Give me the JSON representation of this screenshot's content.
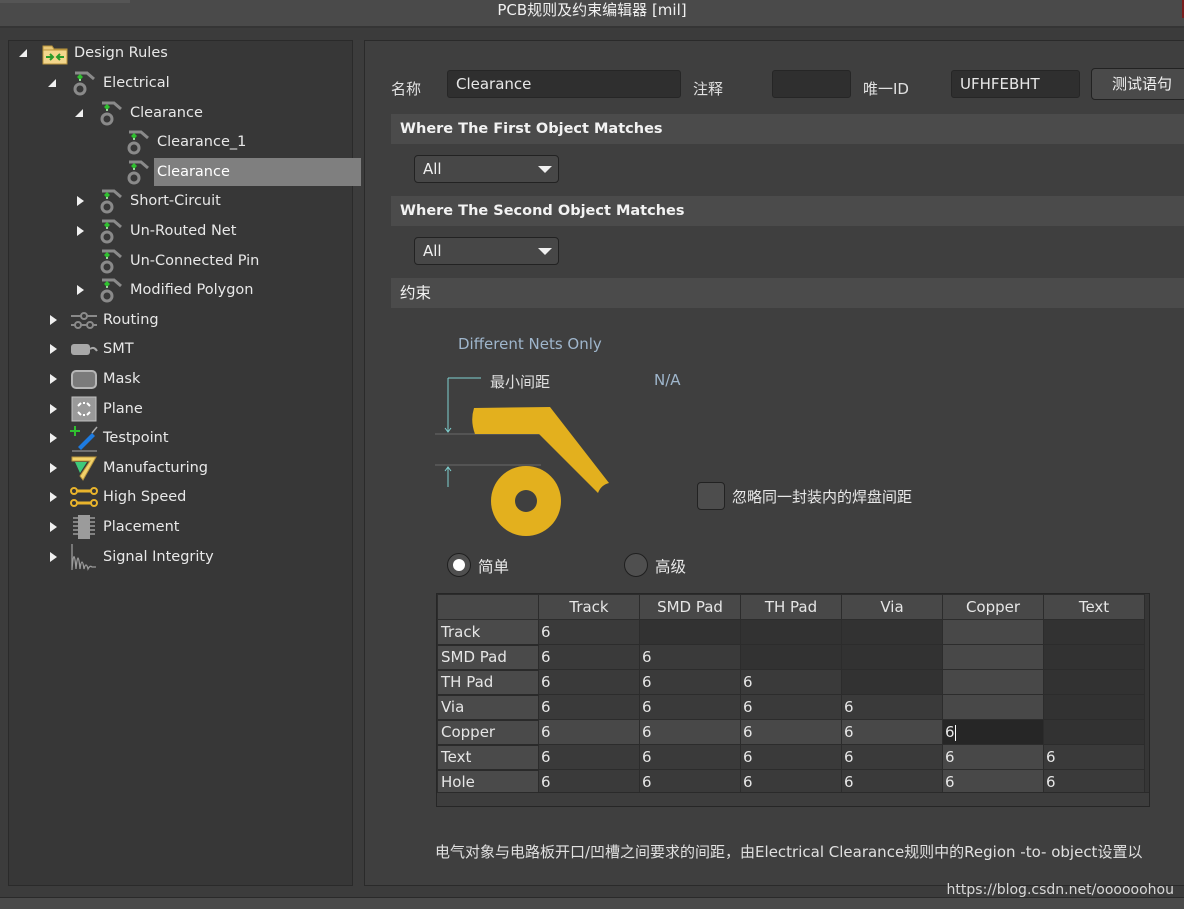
{
  "window": {
    "title": "PCB规则及约束编辑器 [mil]"
  },
  "tree": {
    "root": {
      "label": "Design Rules",
      "icon": "design-rules-folder-icon",
      "expanded": true
    },
    "items": [
      {
        "label": "Electrical",
        "level": 1,
        "expander": "down",
        "icon": "electrical-rule-icon"
      },
      {
        "label": "Clearance",
        "level": 2,
        "expander": "down",
        "icon": "electrical-rule-icon"
      },
      {
        "label": "Clearance_1",
        "level": 3,
        "expander": "none",
        "icon": "electrical-rule-icon"
      },
      {
        "label": "Clearance",
        "level": 3,
        "expander": "none",
        "icon": "electrical-rule-icon",
        "selected": true
      },
      {
        "label": "Short-Circuit",
        "level": 2,
        "expander": "right",
        "icon": "electrical-rule-icon"
      },
      {
        "label": "Un-Routed Net",
        "level": 2,
        "expander": "right",
        "icon": "electrical-rule-icon"
      },
      {
        "label": "Un-Connected Pin",
        "level": 2,
        "expander": "none",
        "icon": "electrical-rule-icon"
      },
      {
        "label": "Modified Polygon",
        "level": 2,
        "expander": "right",
        "icon": "electrical-rule-icon"
      },
      {
        "label": "Routing",
        "level": 1,
        "expander": "right",
        "icon": "routing-icon"
      },
      {
        "label": "SMT",
        "level": 1,
        "expander": "right",
        "icon": "smt-icon"
      },
      {
        "label": "Mask",
        "level": 1,
        "expander": "right",
        "icon": "mask-icon"
      },
      {
        "label": "Plane",
        "level": 1,
        "expander": "right",
        "icon": "plane-icon"
      },
      {
        "label": "Testpoint",
        "level": 1,
        "expander": "right",
        "icon": "testpoint-icon"
      },
      {
        "label": "Manufacturing",
        "level": 1,
        "expander": "right",
        "icon": "manufacturing-icon"
      },
      {
        "label": "High Speed",
        "level": 1,
        "expander": "right",
        "icon": "high-speed-icon"
      },
      {
        "label": "Placement",
        "level": 1,
        "expander": "right",
        "icon": "placement-icon"
      },
      {
        "label": "Signal Integrity",
        "level": 1,
        "expander": "right",
        "icon": "signal-integrity-icon"
      }
    ]
  },
  "rule": {
    "name_label": "名称",
    "name_value": "Clearance",
    "comment_label": "注释",
    "comment_value": "",
    "id_label": "唯一ID",
    "id_value": "UFHFEBHT",
    "test_button": "测试语句"
  },
  "first_match": {
    "title": "Where The First Object Matches",
    "selected": "All"
  },
  "second_match": {
    "title": "Where The Second Object Matches",
    "selected": "All"
  },
  "constraints": {
    "title": "约束",
    "different_nets": "Different Nets Only",
    "min_clearance_label": "最小间距",
    "min_clearance_value": "N/A",
    "ignore_pad_checkbox": {
      "label": "忽略同一封装内的焊盘间距",
      "checked": false
    },
    "mode_simple": {
      "label": "简单",
      "selected": true
    },
    "mode_advanced": {
      "label": "高级",
      "selected": false
    },
    "colors": {
      "copper": "#e3b01e",
      "dimension_line": "#7fd0d0"
    }
  },
  "matrix": {
    "columns": [
      "Track",
      "SMD Pad",
      "TH Pad",
      "Via",
      "Copper",
      "Text"
    ],
    "rows": [
      {
        "name": "Track",
        "values": [
          "6",
          "",
          "",
          "",
          "",
          ""
        ]
      },
      {
        "name": "SMD Pad",
        "values": [
          "6",
          "6",
          "",
          "",
          "",
          ""
        ]
      },
      {
        "name": "TH Pad",
        "values": [
          "6",
          "6",
          "6",
          "",
          "",
          ""
        ]
      },
      {
        "name": "Via",
        "values": [
          "6",
          "6",
          "6",
          "6",
          "",
          ""
        ]
      },
      {
        "name": "Copper",
        "values": [
          "6",
          "6",
          "6",
          "6",
          "6",
          ""
        ]
      },
      {
        "name": "Text",
        "values": [
          "6",
          "6",
          "6",
          "6",
          "6",
          "6"
        ]
      },
      {
        "name": "Hole",
        "values": [
          "6",
          "6",
          "6",
          "6",
          "6",
          "6"
        ]
      }
    ],
    "editing_cell": {
      "row": "Copper",
      "column": "Copper"
    }
  },
  "description": "电气对象与电路板开口/凹槽之间要求的间距，由Electrical Clearance规则中的Region -to- object设置以",
  "watermark": "https://blog.csdn.net/oooooohou"
}
